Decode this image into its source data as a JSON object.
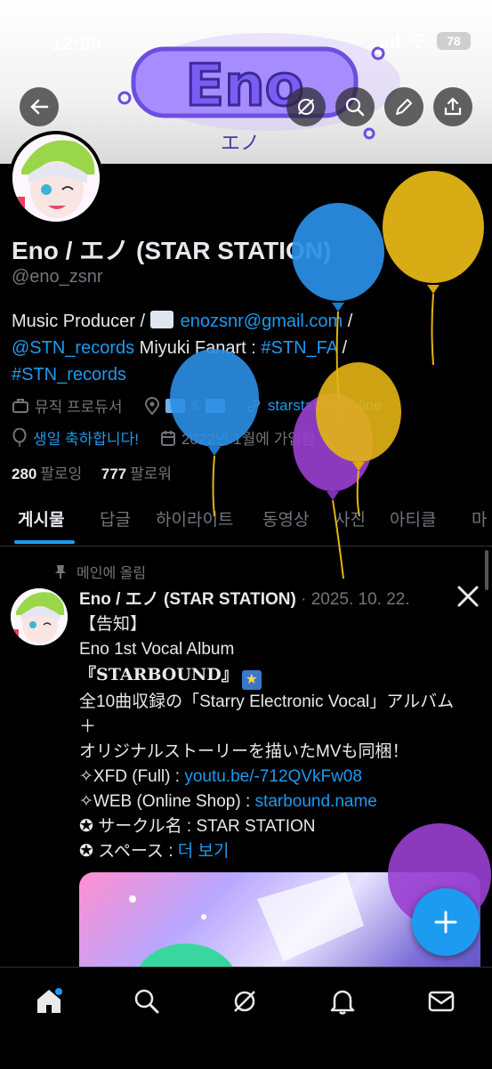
{
  "status_bar": {
    "time": "12:00",
    "battery": "78"
  },
  "banner": {
    "logo_text": "Eno",
    "logo_sub": "エノ"
  },
  "profile": {
    "name": "Eno / エノ (STAR STATION)",
    "handle": "@eno_zsnr",
    "bio": {
      "line1_prefix": "Music Producer / ",
      "email": "enozsnr@gmail.com",
      "line1_suffix": " /",
      "mention1": "@STN_records",
      "middle": " Miyuki Fanart : ",
      "tag1": "#STN_FA",
      "sep": " /",
      "tag2": "#STN_records"
    },
    "meta": {
      "job": "뮤직 프로듀서",
      "location": "& ",
      "website": "starstation.online",
      "birthday": "생일 축하합니다!",
      "joined": "2022년 1월에 가입함"
    },
    "following_count": "280",
    "following_label": "팔로잉",
    "followers_count": "777",
    "followers_label": "팔로워"
  },
  "tabs": [
    "게시물",
    "답글",
    "하이라이트",
    "동영상",
    "사진",
    "아티클",
    "마"
  ],
  "tweet": {
    "pinned_label": "메인에 올림",
    "author": "Eno / エノ (STAR STATION)",
    "date": " · 2025. 10. 22.",
    "lines": {
      "l1": "【告知】",
      "l2": "Eno 1st Vocal Album",
      "l3": "『STARBOUND』",
      "l4": "全10曲収録の「Starry Electronic Vocal」アルバム",
      "l5": "＋",
      "l6": "オリジナルストーリーを描いたMVも同梱！",
      "l7_prefix": "✧XFD (Full) : ",
      "l7_link": "youtu.be/-712QVkFw08",
      "l8_prefix": "✧WEB (Online Shop) : ",
      "l8_link": "starbound.name",
      "l9": "✪ サークル名 : STAR STATION",
      "l10_prefix": "✪ スペース : ",
      "l10_link": "더 보기"
    }
  },
  "colors": {
    "accent": "#1d9bf0",
    "text": "#e7e9ea",
    "muted": "#71767b",
    "bg": "#000000"
  },
  "icons": [
    "back-arrow-icon",
    "grok-icon",
    "search-icon",
    "edit-icon",
    "share-icon",
    "home-icon",
    "explore-icon",
    "grok-nav-icon",
    "notifications-icon",
    "messages-icon",
    "compose-plus-icon",
    "x-logo-icon",
    "pin-icon",
    "briefcase-icon",
    "location-icon",
    "link-icon",
    "balloon-icon",
    "calendar-icon"
  ]
}
